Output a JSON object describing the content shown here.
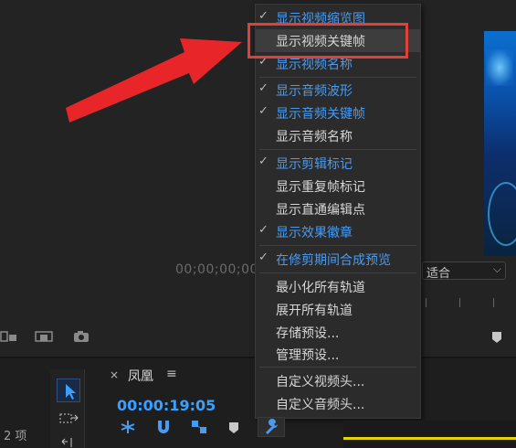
{
  "menu": {
    "items": [
      {
        "label": "显示视频缩览图",
        "checked": true,
        "blue": true
      },
      {
        "label": "显示视频关键帧",
        "checked": false,
        "blue": false,
        "highlighted": true
      },
      {
        "label": "显示视频名称",
        "checked": true,
        "blue": true
      },
      {
        "label": "显示音频波形",
        "checked": true,
        "blue": true
      },
      {
        "label": "显示音频关键帧",
        "checked": true,
        "blue": true
      },
      {
        "label": "显示音频名称",
        "checked": false,
        "blue": false
      },
      {
        "label": "显示剪辑标记",
        "checked": true,
        "blue": true
      },
      {
        "label": "显示重复帧标记",
        "checked": false,
        "blue": false
      },
      {
        "label": "显示直通编辑点",
        "checked": false,
        "blue": false
      },
      {
        "label": "显示效果徽章",
        "checked": true,
        "blue": true
      },
      {
        "label": "在修剪期间合成预览",
        "checked": true,
        "blue": true
      },
      {
        "label": "最小化所有轨道",
        "checked": false,
        "blue": false
      },
      {
        "label": "展开所有轨道",
        "checked": false,
        "blue": false
      },
      {
        "label": "存储预设...",
        "checked": false,
        "blue": false
      },
      {
        "label": "管理预设...",
        "checked": false,
        "blue": false
      },
      {
        "label": "自定义视频头...",
        "checked": false,
        "blue": false
      },
      {
        "label": "自定义音频头...",
        "checked": false,
        "blue": false
      }
    ],
    "check_glyph": "✓"
  },
  "source_monitor": {
    "timecode": "00;00;00;00",
    "fit_label": "适合"
  },
  "sequence": {
    "tab_name": "凤凰",
    "timecode": "00:00:19:05"
  },
  "project": {
    "item_count": "2 项"
  },
  "colors": {
    "accent_blue": "#4a9bf0",
    "highlight_box": "#e0403a",
    "arrow": "#e8262a",
    "timeline_yellow": "#e6d400"
  }
}
